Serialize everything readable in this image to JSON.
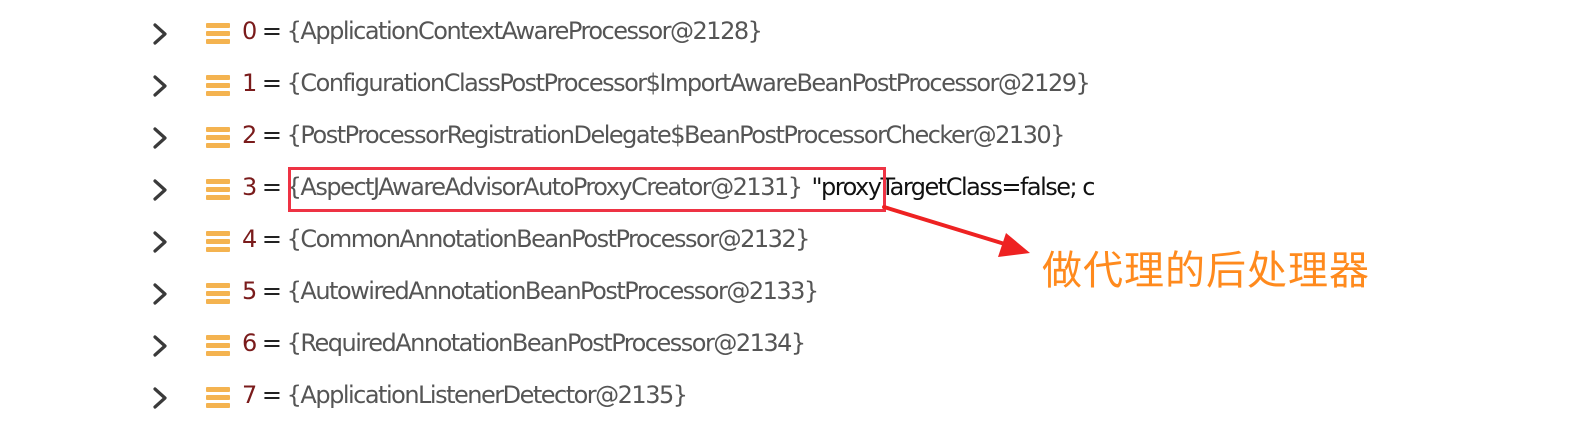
{
  "rows": [
    {
      "index": "0",
      "eq": " = ",
      "value": "{ApplicationContextAwareProcessor@2128}",
      "extra": ""
    },
    {
      "index": "1",
      "eq": " = ",
      "value": "{ConfigurationClassPostProcessor$ImportAwareBeanPostProcessor@2129}",
      "extra": ""
    },
    {
      "index": "2",
      "eq": " = ",
      "value": "{PostProcessorRegistrationDelegate$BeanPostProcessorChecker@2130}",
      "extra": ""
    },
    {
      "index": "3",
      "eq": " = ",
      "value": "{AspectJAwareAdvisorAutoProxyCreator@2131}",
      "extra": "\"proxyTargetClass=false; c"
    },
    {
      "index": "4",
      "eq": " = ",
      "value": "{CommonAnnotationBeanPostProcessor@2132}",
      "extra": ""
    },
    {
      "index": "5",
      "eq": " = ",
      "value": "{AutowiredAnnotationBeanPostProcessor@2133}",
      "extra": ""
    },
    {
      "index": "6",
      "eq": " = ",
      "value": "{RequiredAnnotationBeanPostProcessor@2134}",
      "extra": ""
    },
    {
      "index": "7",
      "eq": " = ",
      "value": "{ApplicationListenerDetector@2135}",
      "extra": ""
    }
  ],
  "annotation": {
    "text": "做代理的后处理器",
    "text_color": "#ff8a1d",
    "box_color": "#ee3344",
    "arrow_color": "#ee2222"
  },
  "icons": {
    "expand": "chevron-right-icon",
    "field": "field-list-icon"
  }
}
